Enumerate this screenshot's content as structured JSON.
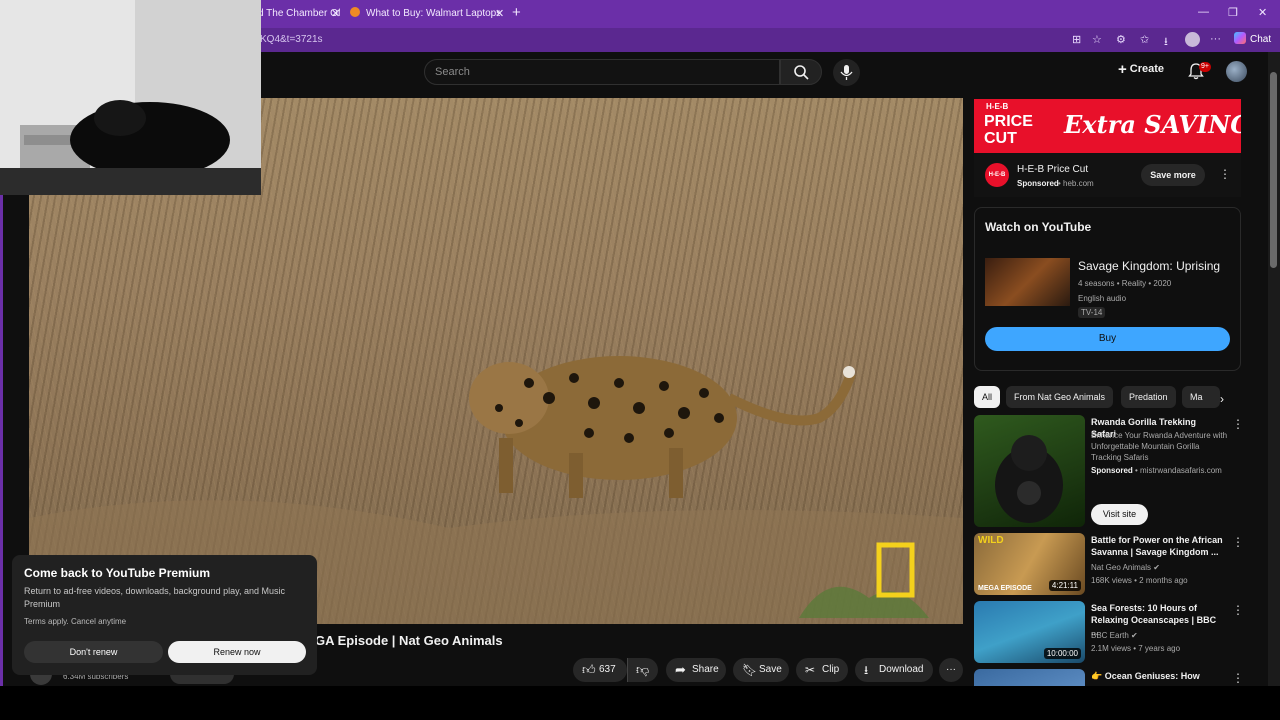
{
  "browser": {
    "tabs": [
      {
        "label": "d The Chamber Of"
      },
      {
        "label": "What to Buy: Walmart Laptops for"
      }
    ],
    "new_tab_icon": "plus-icon",
    "url": "KQ4&t=3721s",
    "chat_label": "Chat"
  },
  "masthead": {
    "search_placeholder": "Search",
    "create_label": "Create",
    "notification_badge": "9+"
  },
  "video": {
    "title_fragment": "GA Episode | Nat Geo Animals",
    "subscribers": "6.34M subscribers",
    "actions": {
      "like_count": "637",
      "share_label": "Share",
      "save_label": "Save",
      "clip_label": "Clip",
      "download_label": "Download"
    }
  },
  "premium_toast": {
    "title": "Come back to YouTube Premium",
    "body": "Return to ad-free videos, downloads, background play, and Music Premium",
    "terms": "Terms apply. Cancel anytime",
    "dont_renew": "Don't renew",
    "renew_now": "Renew now"
  },
  "ad": {
    "banner_price": "PRICE CUT",
    "banner_brand": "H-E-B",
    "banner_tagline": "Extra SAVINGS",
    "advertiser": "H-E-B Price Cut",
    "sponsored": "Sponsored",
    "domain": "heb.com",
    "cta": "Save more"
  },
  "watch_on_youtube": {
    "heading": "Watch on YouTube",
    "show_title": "Savage Kingdom: Uprising",
    "meta": "4 seasons • Reality • 2020",
    "audio": "English audio",
    "rating": "TV-14",
    "buy_label": "Buy"
  },
  "chips": [
    "All",
    "From Nat Geo Animals",
    "Predation",
    "Ma"
  ],
  "recommendations": [
    {
      "title": "Rwanda Gorilla Trekking Safari",
      "description": "Enhance Your Rwanda Adventure with Unforgettable Mountain Gorilla Tracking Safaris",
      "sponsored": "Sponsored",
      "domain": "mistrwandasafaris.com",
      "cta": "Visit site"
    },
    {
      "title": "Battle for Power on the African Savanna | Savage Kingdom ...",
      "channel": "Nat Geo Animals",
      "meta": "168K views • 2 months ago",
      "duration": "4:21:11",
      "thumb_badge_top": "WILD",
      "thumb_badge_bottom": "MEGA EPISODE"
    },
    {
      "title": "Sea Forests: 10 Hours of Relaxing Oceanscapes | BBC ...",
      "channel": "BBC Earth",
      "meta": "2.1M views • 7 years ago",
      "duration": "10:00:00"
    },
    {
      "title": "👉 Ocean Geniuses: How"
    }
  ]
}
